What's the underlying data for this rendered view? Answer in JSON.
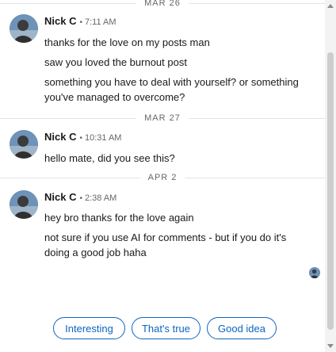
{
  "thread": {
    "groups": [
      {
        "date": "MAR 26",
        "sender": "Nick C",
        "time": "7:11 AM",
        "messages": [
          "thanks for the love on my posts man",
          "saw you loved the burnout post",
          "something you have to deal with yourself? or something you've managed to overcome?"
        ]
      },
      {
        "date": "MAR 27",
        "sender": "Nick C",
        "time": "10:31 AM",
        "messages": [
          "hello mate, did you see this?"
        ]
      },
      {
        "date": "APR 2",
        "sender": "Nick C",
        "time": "2:38 AM",
        "messages": [
          "hey bro thanks for the love again",
          "not sure if you use AI for comments - but if you do it's doing a good job haha"
        ]
      }
    ],
    "separator": "•"
  },
  "suggestions": [
    "Interesting",
    "That's true",
    "Good idea"
  ],
  "colors": {
    "accent": "#0a66c2",
    "text": "#1a1a1a",
    "muted": "#666666",
    "divider": "#e3e3e3"
  },
  "icons": {
    "avatar": "user-avatar",
    "seen": "seen-receipt-avatar"
  }
}
